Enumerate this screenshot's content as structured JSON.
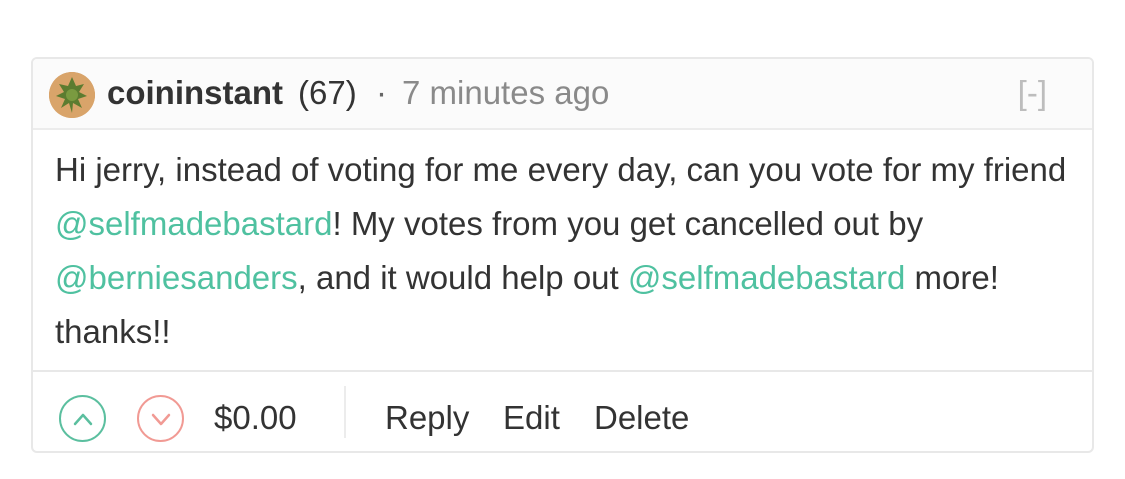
{
  "comment": {
    "author": "coininstant",
    "reputation": "(67)",
    "separator": "·",
    "timestamp": "7 minutes ago",
    "collapse_label": "[-]",
    "body": {
      "part1": "Hi jerry, instead of voting for me every day, can you vote for my friend ",
      "mention1": "@selfmadebastard",
      "part2": "! My votes from you get cancelled out by ",
      "mention2": "@berniesanders",
      "part3": ", and it would help out ",
      "mention3": "@selfmadebastard",
      "part4": " more! thanks!!"
    },
    "payout": "$0.00",
    "actions": {
      "reply": "Reply",
      "edit": "Edit",
      "delete": "Delete"
    }
  },
  "icons": {
    "avatar": "avatar-image",
    "upvote": "chevron-up-icon",
    "downvote": "chevron-down-icon"
  },
  "colors": {
    "mention": "#4fc1a0",
    "upvote": "#5bbf9f",
    "downvote": "#f19a94",
    "muted_text": "#8a8a8a"
  }
}
